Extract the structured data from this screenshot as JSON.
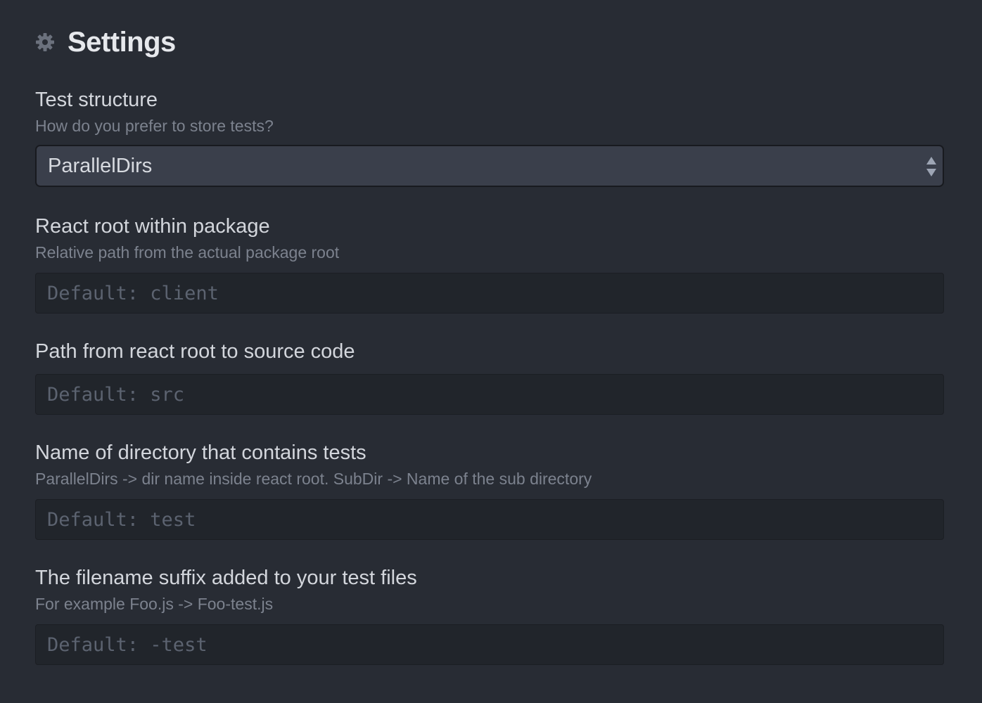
{
  "header": {
    "title": "Settings",
    "icon": "gear-icon"
  },
  "settings": [
    {
      "label": "Test structure",
      "description": "How do you prefer to store tests?",
      "type": "select",
      "value": "ParallelDirs"
    },
    {
      "label": "React root within package",
      "description": "Relative path from the actual package root",
      "type": "text",
      "value": "",
      "placeholder": "Default: client"
    },
    {
      "label": "Path from react root to source code",
      "type": "text",
      "value": "",
      "placeholder": "Default: src"
    },
    {
      "label": "Name of directory that contains tests",
      "description": "ParallelDirs -> dir name inside react root. SubDir -> Name of the sub directory",
      "type": "text",
      "value": "",
      "placeholder": "Default: test"
    },
    {
      "label": "The filename suffix added to your test files",
      "description": "For example Foo.js -> Foo-test.js",
      "type": "text",
      "value": "",
      "placeholder": "Default: -test"
    }
  ],
  "colors": {
    "background": "#282c34",
    "input_background": "#21252b",
    "select_background": "#3a3f4b",
    "text": "#d7dae0",
    "muted_text": "#7c828e"
  }
}
